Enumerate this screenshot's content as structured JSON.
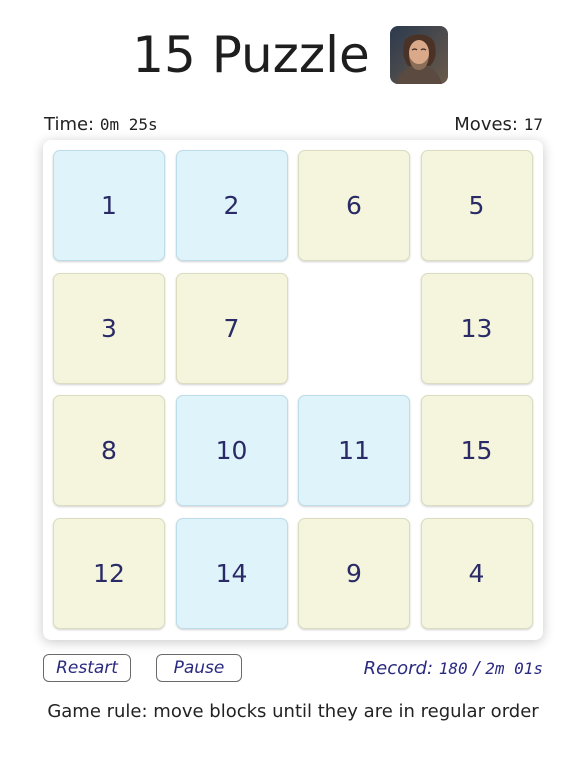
{
  "header": {
    "title": "15 Puzzle"
  },
  "stats": {
    "time_label": "Time:",
    "time_value": "0m 25s",
    "moves_label": "Moves:",
    "moves_value": "17"
  },
  "board": {
    "tiles": [
      "1",
      "2",
      "6",
      "5",
      "3",
      "7",
      "",
      "13",
      "8",
      "10",
      "11",
      "15",
      "12",
      "14",
      "9",
      "4"
    ],
    "tile_colors": [
      "blue",
      "blue",
      "cream",
      "cream",
      "cream",
      "cream",
      "empty",
      "cream",
      "cream",
      "blue",
      "blue",
      "cream",
      "cream",
      "blue",
      "cream",
      "cream"
    ]
  },
  "controls": {
    "restart_label": "Restart",
    "pause_label": "Pause",
    "record_label": "Record:",
    "record_moves": "180",
    "record_separator": "/",
    "record_time": "2m 01s"
  },
  "footer": {
    "rule_text": "Game rule: move blocks until they are in regular order"
  },
  "colors": {
    "tile_blue": "#dff3fb",
    "tile_cream": "#f4f5dc",
    "tile_text": "#2a2a66",
    "accent_text": "#2a2a80"
  }
}
